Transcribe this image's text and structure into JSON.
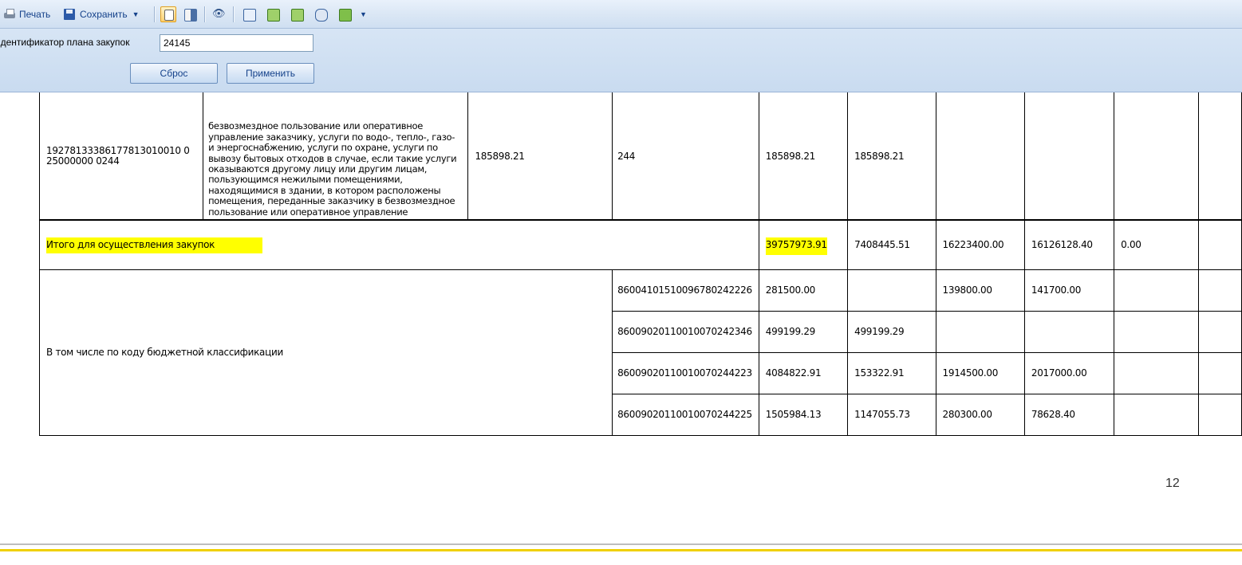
{
  "toolbar": {
    "print_label": "Печать",
    "save_label": "Сохранить"
  },
  "filter": {
    "label": "Идентификатор плана закупок",
    "value": "24145",
    "reset_label": "Сброс",
    "apply_label": "Применить"
  },
  "table": {
    "row1": {
      "code": "19278133386177813010010025000000 0244",
      "code_line1": "19278133386177813010010 0",
      "code_line2": "25000000 0244",
      "description_top": "безвозмездное пользование или оперативное управление заказчику, услуги по водо-, тепло-, газо- и энергоснабжению, услуги по охране, услуги по вывозу бытовых отходов в случае, если такие услуги оказываются другому лицу или другим лицам, пользующимся нежилыми помещениями, находящимися в здании, в котором расположены помещения, переданные заказчику в безвозмездное пользование или оперативное управление",
      "amount": "185898.21",
      "kvr": "244",
      "total": "185898.21",
      "year1": "185898.21"
    },
    "total_row": {
      "label": "Итого для осуществления закупок",
      "total": "39757973.91",
      "c1": "7408445.51",
      "c2": "16223400.00",
      "c3": "16126128.40",
      "c4": "0.00"
    },
    "kbk_label": "В том числе по коду бюджетной классификации",
    "kbk_rows": [
      {
        "code": "86004101510096780242226",
        "total": "281500.00",
        "c1": "",
        "c2": "139800.00",
        "c3": "141700.00"
      },
      {
        "code": "86009020110010070242346",
        "total": "499199.29",
        "c1": "499199.29",
        "c2": "",
        "c3": ""
      },
      {
        "code": "86009020110010070244223",
        "total": "4084822.91",
        "c1": "153322.91",
        "c2": "1914500.00",
        "c3": "2017000.00"
      },
      {
        "code": "86009020110010070244225",
        "total": "1505984.13",
        "c1": "1147055.73",
        "c2": "280300.00",
        "c3": "78628.40"
      }
    ]
  },
  "page_number": "12",
  "colors": {
    "highlight": "#ffff00",
    "toolbar_text": "#15428b"
  }
}
